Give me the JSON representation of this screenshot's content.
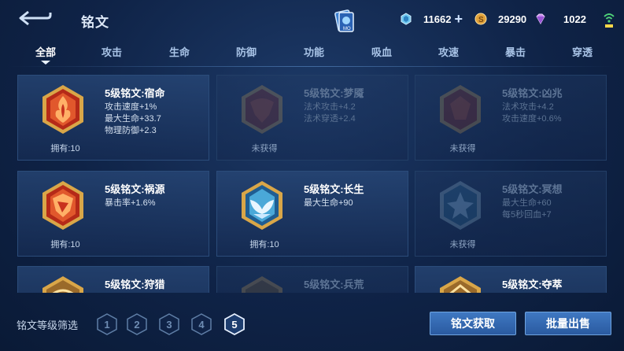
{
  "header": {
    "title": "铭文",
    "currencies": [
      {
        "name": "diamond-coupon",
        "value": "11662",
        "icon": "blue-crystal-icon"
      },
      {
        "name": "gold",
        "value": "29290",
        "icon": "gold-coin-icon"
      },
      {
        "name": "diamond",
        "value": "1022",
        "icon": "purple-gem-icon"
      }
    ]
  },
  "tabs": [
    {
      "label": "全部",
      "active": true
    },
    {
      "label": "攻击",
      "active": false
    },
    {
      "label": "生命",
      "active": false
    },
    {
      "label": "防御",
      "active": false
    },
    {
      "label": "功能",
      "active": false
    },
    {
      "label": "吸血",
      "active": false
    },
    {
      "label": "攻速",
      "active": false
    },
    {
      "label": "暴击",
      "active": false
    },
    {
      "label": "穿透",
      "active": false
    }
  ],
  "cards": [
    {
      "name": "5级铭文:宿命",
      "stats": [
        "攻击速度+1%",
        "最大生命+33.7",
        "物理防御+2.3"
      ],
      "owned": "拥有:10",
      "obtained": true,
      "color": "red"
    },
    {
      "name": "5级铭文:梦魇",
      "stats": [
        "法术攻击+4.2",
        "法术穿透+2.4"
      ],
      "owned": "未获得",
      "obtained": false,
      "color": "red"
    },
    {
      "name": "5级铭文:凶兆",
      "stats": [
        "法术攻击+4.2",
        "攻击速度+0.6%"
      ],
      "owned": "未获得",
      "obtained": false,
      "color": "red"
    },
    {
      "name": "5级铭文:祸源",
      "stats": [
        "暴击率+1.6%"
      ],
      "owned": "拥有:10",
      "obtained": true,
      "color": "red"
    },
    {
      "name": "5级铭文:长生",
      "stats": [
        "最大生命+90"
      ],
      "owned": "拥有:10",
      "obtained": true,
      "color": "blue"
    },
    {
      "name": "5级铭文:冥想",
      "stats": [
        "最大生命+60",
        "每5秒回血+7"
      ],
      "owned": "未获得",
      "obtained": false,
      "color": "blue"
    },
    {
      "name": "5级铭文:狩猎",
      "stats": [],
      "owned": "",
      "obtained": true,
      "color": "gold"
    },
    {
      "name": "5级铭文:兵荒",
      "stats": [],
      "owned": "",
      "obtained": false,
      "color": "gold"
    },
    {
      "name": "5级铭文:夺萃",
      "stats": [],
      "owned": "",
      "obtained": true,
      "color": "gold"
    }
  ],
  "footer": {
    "filter_label": "铭文等级筛选",
    "levels": [
      "1",
      "2",
      "3",
      "4",
      "5"
    ],
    "selected_level": "5",
    "obtain_button": "铭文获取",
    "sell_button": "批量出售"
  },
  "colors": {
    "accent": "#3f78c2",
    "background": "#0f2347",
    "red_gem": "#c8321e",
    "blue_gem": "#4aa8d8",
    "gold_frame": "#d9a648"
  }
}
